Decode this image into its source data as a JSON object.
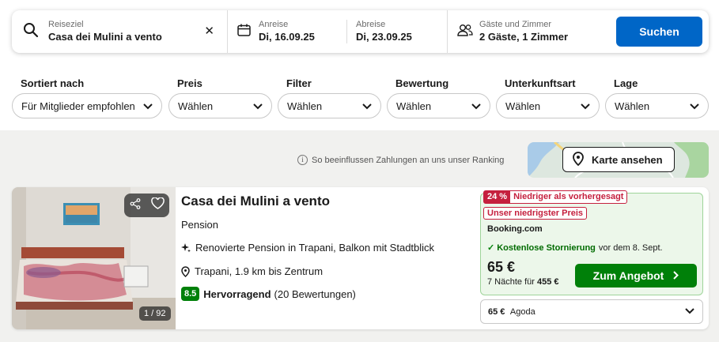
{
  "search": {
    "destination_label": "Reiseziel",
    "destination_value": "Casa dei Mulini a vento",
    "clear_symbol": "✕",
    "checkin_label": "Anreise",
    "checkin_value": "Di, 16.09.25",
    "checkout_label": "Abreise",
    "checkout_value": "Di, 23.09.25",
    "guests_label": "Gäste und Zimmer",
    "guests_value": "2 Gäste, 1 Zimmer",
    "search_button": "Suchen"
  },
  "filters": [
    {
      "label": "Sortiert nach",
      "value": "Für Mitglieder empfohlen"
    },
    {
      "label": "Preis",
      "value": "Wählen"
    },
    {
      "label": "Filter",
      "value": "Wählen"
    },
    {
      "label": "Bewertung",
      "value": "Wählen"
    },
    {
      "label": "Unterkunftsart",
      "value": "Wählen"
    },
    {
      "label": "Lage",
      "value": "Wählen"
    }
  ],
  "ranking_note": "So beeinflussen Zahlungen an uns unser Ranking",
  "map_button": "Karte ansehen",
  "hotel": {
    "name": "Casa dei Mulini a vento",
    "type": "Pension",
    "feature": "Renovierte Pension in Trapani, Balkon mit Stadtblick",
    "location": "Trapani, 1.9 km bis Zentrum",
    "score": "8.5",
    "rating_word": "Hervorragend",
    "reviews": "(20 Bewertungen)",
    "photo_count": "1 / 92"
  },
  "deal": {
    "discount_pct": "24 %",
    "discount_text": "Niedriger als vorhergesagt",
    "lowest_price_badge": "Unser niedrigster Preis",
    "provider": "Booking.com",
    "cancel_bold": "Kostenlose Stornierung",
    "cancel_rest": "vor dem 8. Sept.",
    "price": "65 €",
    "total_prefix": "7 Nächte für",
    "total_price": "455 €",
    "cta": "Zum Angebot"
  },
  "alt_deal": {
    "price": "65 €",
    "provider": "Agoda"
  },
  "colors": {
    "primary_blue": "#0066c7",
    "deal_green": "#008009",
    "badge_red": "#c5203e",
    "deal_bg": "#ecf7ea"
  }
}
